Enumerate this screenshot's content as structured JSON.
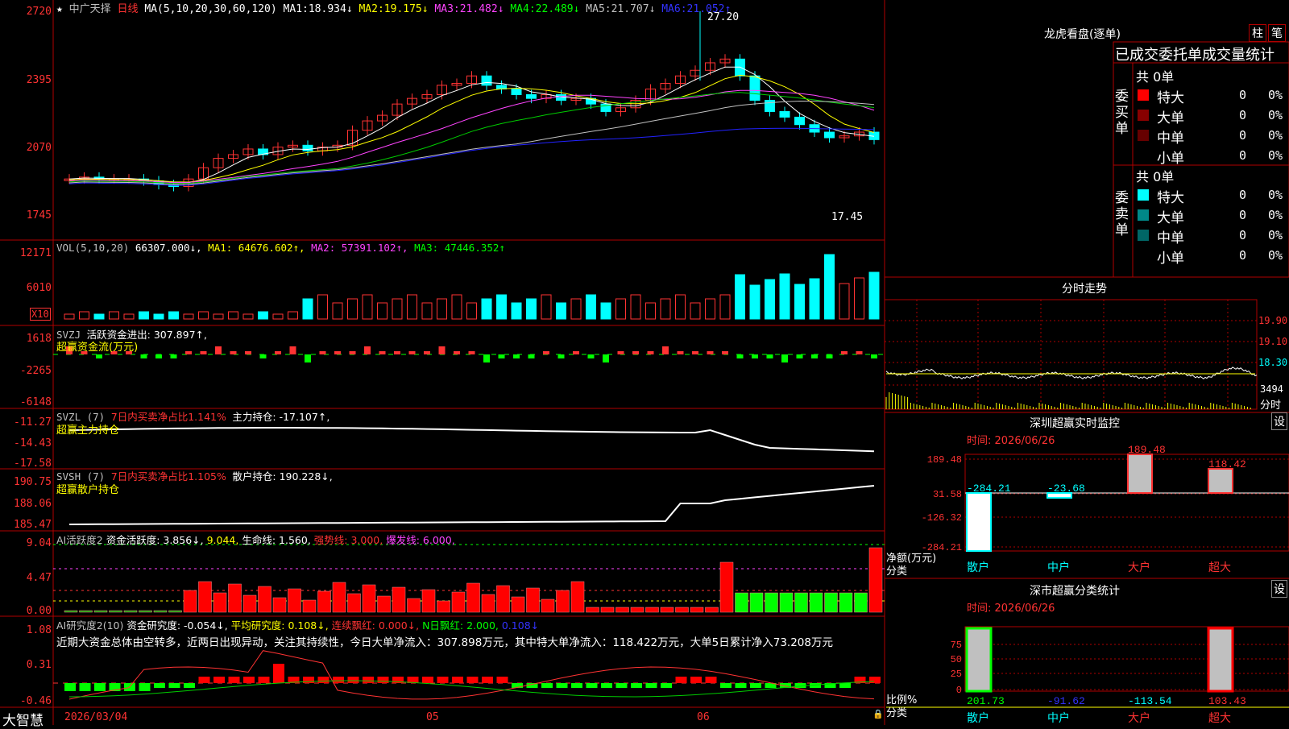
{
  "colors": {
    "up": "#ff3333",
    "down": "#00ffff",
    "grid": "#b00000",
    "ma1": "#ffffff",
    "ma2": "#ffff00",
    "ma3": "#ff44ff",
    "ma4": "#00cc00",
    "ma5": "#c0c0c0",
    "ma6": "#2222ff"
  },
  "header": {
    "star": "★",
    "stock": "中广天择",
    "period": "日线",
    "ma_label": "MA(5,10,20,30,60,120)",
    "ma_values": [
      {
        "label": "MA1:",
        "value": "18.934↓"
      },
      {
        "label": "MA2:",
        "value": "19.175↓"
      },
      {
        "label": "MA3:",
        "value": "21.482↓"
      },
      {
        "label": "MA4:",
        "value": "22.489↓"
      },
      {
        "label": "MA5:",
        "value": "21.707↓"
      },
      {
        "label": "MA6:",
        "value": "21.052↑"
      }
    ],
    "high_marker": "27.20",
    "low_marker": "17.45"
  },
  "axes": {
    "main": [
      "2720",
      "2395",
      "2070",
      "1745"
    ],
    "vol": [
      "12171",
      "6010",
      "X10"
    ],
    "svzj": [
      "1618",
      "-2265",
      "-6148"
    ],
    "svzl": [
      "-11.27",
      "-14.43",
      "-17.58"
    ],
    "svsh": [
      "190.75",
      "188.06",
      "185.47"
    ],
    "ai1": [
      "9.04",
      "4.47",
      "0.00"
    ],
    "ai2": [
      "1.08",
      "0.31",
      "-0.46"
    ]
  },
  "panels": {
    "vol": {
      "name": "VOL(5,10,20)",
      "value": "66307.000↓,",
      "ma1": "MA1: 64676.602↑,",
      "ma2": "MA2: 57391.102↑,",
      "ma3": "MA3: 47446.352↑"
    },
    "svzj": {
      "name": "SVZJ",
      "title": "活跃资金进出: 307.897↑,",
      "sub": "超赢资金流(万元)"
    },
    "svzl": {
      "name": "SVZL (7)",
      "title": "7日内买卖净占比1.141%",
      "title2": "主力持仓: -17.107↑,",
      "sub": "超赢主力持仓"
    },
    "svsh": {
      "name": "SVSH (7)",
      "title": "7日内买卖净占比1.105%",
      "title2": "散户持仓: 190.228↓,",
      "sub": "超赢散户持仓"
    },
    "ai1": {
      "name": "AI活跃度2",
      "t1": "资金活跃度: 3.856↓,",
      "t2": "9.044,",
      "t3": "生命线: 1.560,",
      "t4": "强势线: 3.000,",
      "t5": "爆发线: 6.000,"
    },
    "ai2": {
      "name": "AI研究度2(10)",
      "t1": "资金研究度: -0.054↓,",
      "t2": "平均研究度: 0.108↓,",
      "t3": "连续飘红: 0.000↓,",
      "t4": "N日飘红: 2.000,",
      "t5": "0.108↓",
      "comment": "近期大资金总体由空转多，近两日出现异动，关注其持续性，今日大单净流入：307.898万元，其中特大单净流入：118.422万元，大单5日累计净入73.208万元"
    }
  },
  "footer": {
    "brand": "大智慧",
    "date1": "2026/03/04",
    "m5": "05",
    "m6": "06",
    "lock": "🔒"
  },
  "right": {
    "lhkp": {
      "title": "龙虎看盘(逐单)",
      "btn1": "柱",
      "btn2": "笔",
      "subtitle": "已成交委托单成交量统计",
      "buy": {
        "side": "委买单",
        "count": "共 0单",
        "rows": [
          {
            "name": "特大",
            "color": "#ff0000",
            "v": "0",
            "p": "0%"
          },
          {
            "name": "大单",
            "color": "#880000",
            "v": "0",
            "p": "0%"
          },
          {
            "name": "中单",
            "color": "#660000",
            "v": "0",
            "p": "0%"
          },
          {
            "name": "小单",
            "color": "",
            "v": "0",
            "p": "0%"
          }
        ]
      },
      "sell": {
        "side": "委卖单",
        "count": "共 0单",
        "rows": [
          {
            "name": "特大",
            "color": "#00ffff",
            "v": "0",
            "p": "0%"
          },
          {
            "name": "大单",
            "color": "#008888",
            "v": "0",
            "p": "0%"
          },
          {
            "name": "中单",
            "color": "#006666",
            "v": "0",
            "p": "0%"
          },
          {
            "name": "小单",
            "color": "",
            "v": "0",
            "p": "0%"
          }
        ]
      }
    },
    "fszs": {
      "title": "分时走势",
      "y": [
        "19.90",
        "19.10",
        "18.30"
      ],
      "vol": "3494",
      "vlabel": "分时"
    },
    "rt": {
      "title": "深圳超赢实时监控",
      "btn": "设",
      "time": "时间: 2026/06/26",
      "y": [
        "189.48",
        "31.58",
        "-126.32",
        "-284.21"
      ],
      "bars": [
        {
          "cat": "散户",
          "value": -284.21,
          "label": "-284.21"
        },
        {
          "cat": "中户",
          "value": -23.68,
          "label": "-23.68"
        },
        {
          "cat": "大户",
          "value": 189.48,
          "label": "189.48"
        },
        {
          "cat": "超大",
          "value": 118.42,
          "label": "118.42"
        }
      ],
      "ylab1": "净额(万元)",
      "ylab2": "分类"
    },
    "cls": {
      "title": "深市超赢分类统计",
      "btn": "设",
      "time": "时间: 2026/06/26",
      "y": [
        "75",
        "50",
        "25",
        "0"
      ],
      "bars": [
        {
          "cat": "散户",
          "label": "201.73"
        },
        {
          "cat": "中户",
          "label": "-91.62"
        },
        {
          "cat": "大户",
          "label": "-113.54"
        },
        {
          "cat": "超大",
          "label": "103.43"
        }
      ],
      "ylab1": "比例%",
      "ylab2": "分类"
    }
  }
}
